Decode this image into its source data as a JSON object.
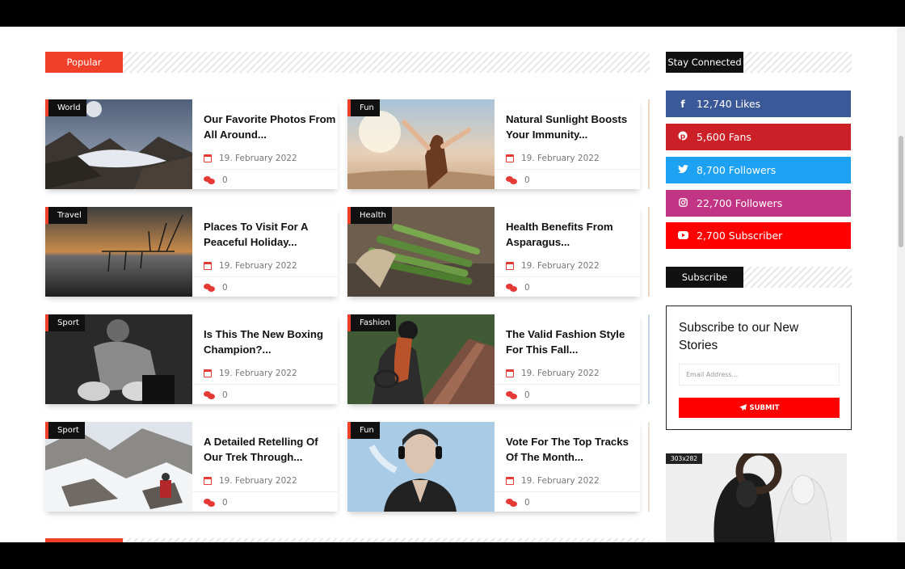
{
  "sections": {
    "popular_label": "Popular",
    "stay_connected_label": "Stay Connected",
    "subscribe_label": "Subscribe"
  },
  "posts": [
    {
      "category": "World",
      "title": "Our Favorite Photos From All Around...",
      "date": "19. February 2022",
      "comments": "0"
    },
    {
      "category": "Fun",
      "title": "Natural Sunlight Boosts Your Immunity...",
      "date": "19. February 2022",
      "comments": "0"
    },
    {
      "category": "Travel",
      "title": "Places To Visit For A Peaceful Holiday...",
      "date": "19. February 2022",
      "comments": "0"
    },
    {
      "category": "Health",
      "title": "Health Benefits From Asparagus...",
      "date": "19. February 2022",
      "comments": "0"
    },
    {
      "category": "Sport",
      "title": "Is This The New Boxing Champion?...",
      "date": "19. February 2022",
      "comments": "0"
    },
    {
      "category": "Fashion",
      "title": "The Valid Fashion Style For This Fall...",
      "date": "19. February 2022",
      "comments": "0"
    },
    {
      "category": "Sport",
      "title": "A Detailed Retelling Of Our Trek Through...",
      "date": "19. February 2022",
      "comments": "0"
    },
    {
      "category": "Fun",
      "title": "Vote For The Top Tracks Of The Month...",
      "date": "19. February 2022",
      "comments": "0"
    }
  ],
  "social": [
    {
      "icon": "facebook-icon",
      "label": "12,740 Likes",
      "color": "#3b5998"
    },
    {
      "icon": "pinterest-icon",
      "label": "5,600 Fans",
      "color": "#cb2027"
    },
    {
      "icon": "twitter-icon",
      "label": "8,700 Followers",
      "color": "#1da1f2"
    },
    {
      "icon": "instagram-icon",
      "label": "22,700 Followers",
      "color": "#c13584"
    },
    {
      "icon": "youtube-icon",
      "label": "2,700 Subscriber",
      "color": "#ff0000"
    }
  ],
  "subscribe": {
    "title": "Subscribe to our New Stories",
    "email_placeholder": "Email Address...",
    "submit_label": "SUBMIT"
  },
  "ad": {
    "size_label": "303x282"
  },
  "colors": {
    "accent": "#f0402a",
    "dark": "#111111",
    "submit": "#ff0000"
  }
}
